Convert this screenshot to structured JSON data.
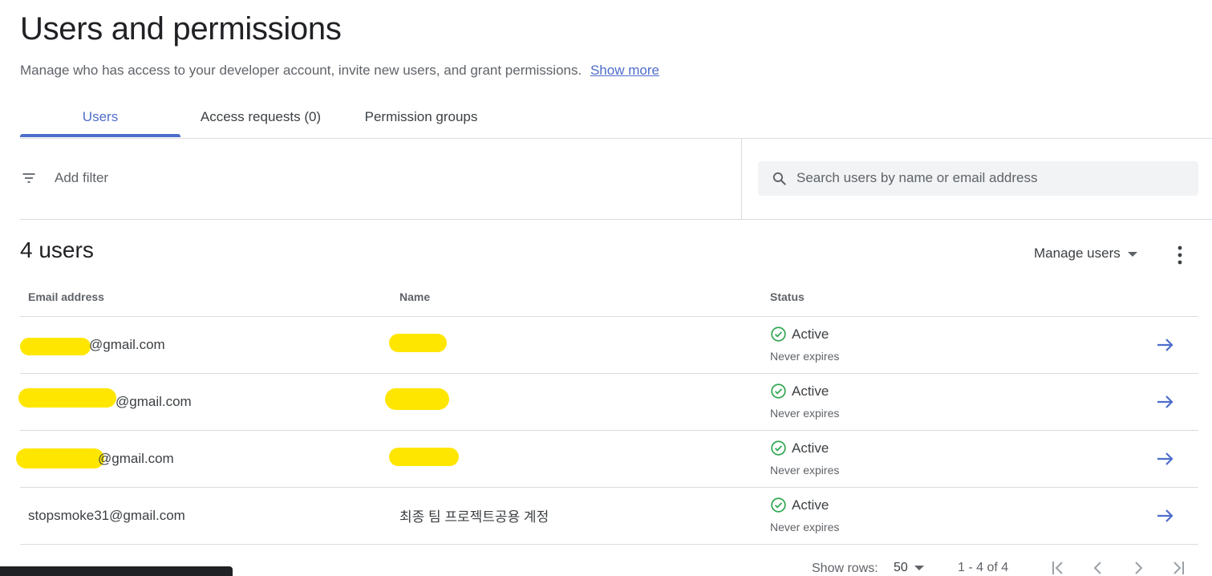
{
  "header": {
    "title": "Users and permissions",
    "description": "Manage who has access to your developer account, invite new users, and grant permissions.",
    "show_more": "Show more"
  },
  "tabs": [
    {
      "label": "Users",
      "active": true
    },
    {
      "label": "Access requests (0)",
      "active": false
    },
    {
      "label": "Permission groups",
      "active": false
    }
  ],
  "filter": {
    "label": "Add filter",
    "icon": "filter-icon"
  },
  "search": {
    "placeholder": "Search users by name or email address",
    "icon": "search-icon"
  },
  "users_section": {
    "count_label": "4 users",
    "manage_label": "Manage users"
  },
  "table": {
    "columns": [
      "Email address",
      "Name",
      "Status"
    ],
    "rows": [
      {
        "email": "@gmail.com",
        "name": "",
        "status": "Active",
        "expiry": "Never expires",
        "redacted": true
      },
      {
        "email": "@gmail.com",
        "name": "",
        "status": "Active",
        "expiry": "Never expires",
        "redacted": true
      },
      {
        "email": "@gmail.com",
        "name": "",
        "status": "Active",
        "expiry": "Never expires",
        "redacted": true
      },
      {
        "email": "stopsmoke31@gmail.com",
        "name": "최종 팀 프로젝트공용 계정",
        "status": "Active",
        "expiry": "Never expires",
        "redacted": false
      }
    ]
  },
  "pagination": {
    "show_rows_label": "Show rows:",
    "rows_value": "50",
    "range": "1 - 4 of 4"
  },
  "colors": {
    "accent": "#4e6dcb",
    "status_ok": "#34a853",
    "redaction": "#ffe600"
  }
}
